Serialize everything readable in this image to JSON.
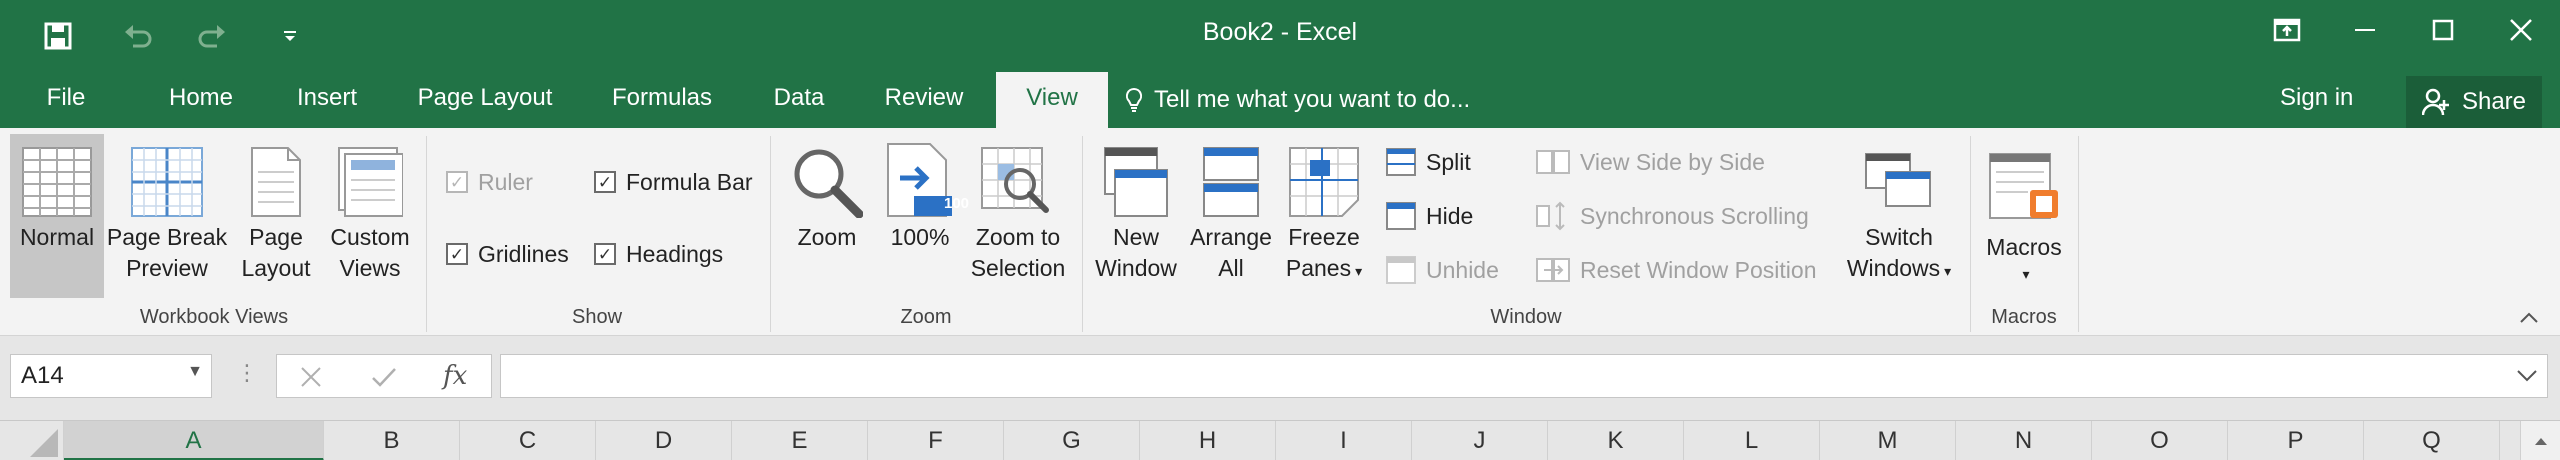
{
  "window": {
    "title": "Book2 - Excel"
  },
  "colors": {
    "brand": "#217346",
    "ribbon_bg": "#f3f3f3",
    "selected_button": "#c6c6c6"
  },
  "tabs": [
    {
      "label": "File"
    },
    {
      "label": "Home"
    },
    {
      "label": "Insert"
    },
    {
      "label": "Page Layout"
    },
    {
      "label": "Formulas"
    },
    {
      "label": "Data"
    },
    {
      "label": "Review"
    },
    {
      "label": "View"
    }
  ],
  "active_tab": "View",
  "tell_me": "Tell me what you want to do...",
  "sign_in": "Sign in",
  "share": "Share",
  "groups": {
    "workbook_views": {
      "label": "Workbook Views",
      "normal": "Normal",
      "page_break_1": "Page Break",
      "page_break_2": "Preview",
      "page_layout_1": "Page",
      "page_layout_2": "Layout",
      "custom_1": "Custom",
      "custom_2": "Views"
    },
    "show": {
      "label": "Show",
      "ruler": "Ruler",
      "formula_bar": "Formula Bar",
      "gridlines": "Gridlines",
      "headings": "Headings"
    },
    "zoom": {
      "label": "Zoom",
      "zoom": "Zoom",
      "hundred": "100%",
      "hundred_badge": "100",
      "zoom_sel_1": "Zoom to",
      "zoom_sel_2": "Selection"
    },
    "window": {
      "label": "Window",
      "new_1": "New",
      "new_2": "Window",
      "arrange_1": "Arrange",
      "arrange_2": "All",
      "freeze_1": "Freeze",
      "freeze_2": "Panes",
      "split": "Split",
      "hide": "Hide",
      "unhide": "Unhide",
      "side_by_side": "View Side by Side",
      "sync_scroll": "Synchronous Scrolling",
      "reset_pos": "Reset Window Position",
      "switch_1": "Switch",
      "switch_2": "Windows"
    },
    "macros": {
      "label": "Macros",
      "macros": "Macros"
    }
  },
  "formula_bar": {
    "name_box": "A14",
    "fx": "fx",
    "formula": ""
  },
  "columns": [
    "A",
    "B",
    "C",
    "D",
    "E",
    "F",
    "G",
    "H",
    "I",
    "J",
    "K",
    "L",
    "M",
    "N",
    "O",
    "P",
    "Q"
  ],
  "active_column": "A"
}
